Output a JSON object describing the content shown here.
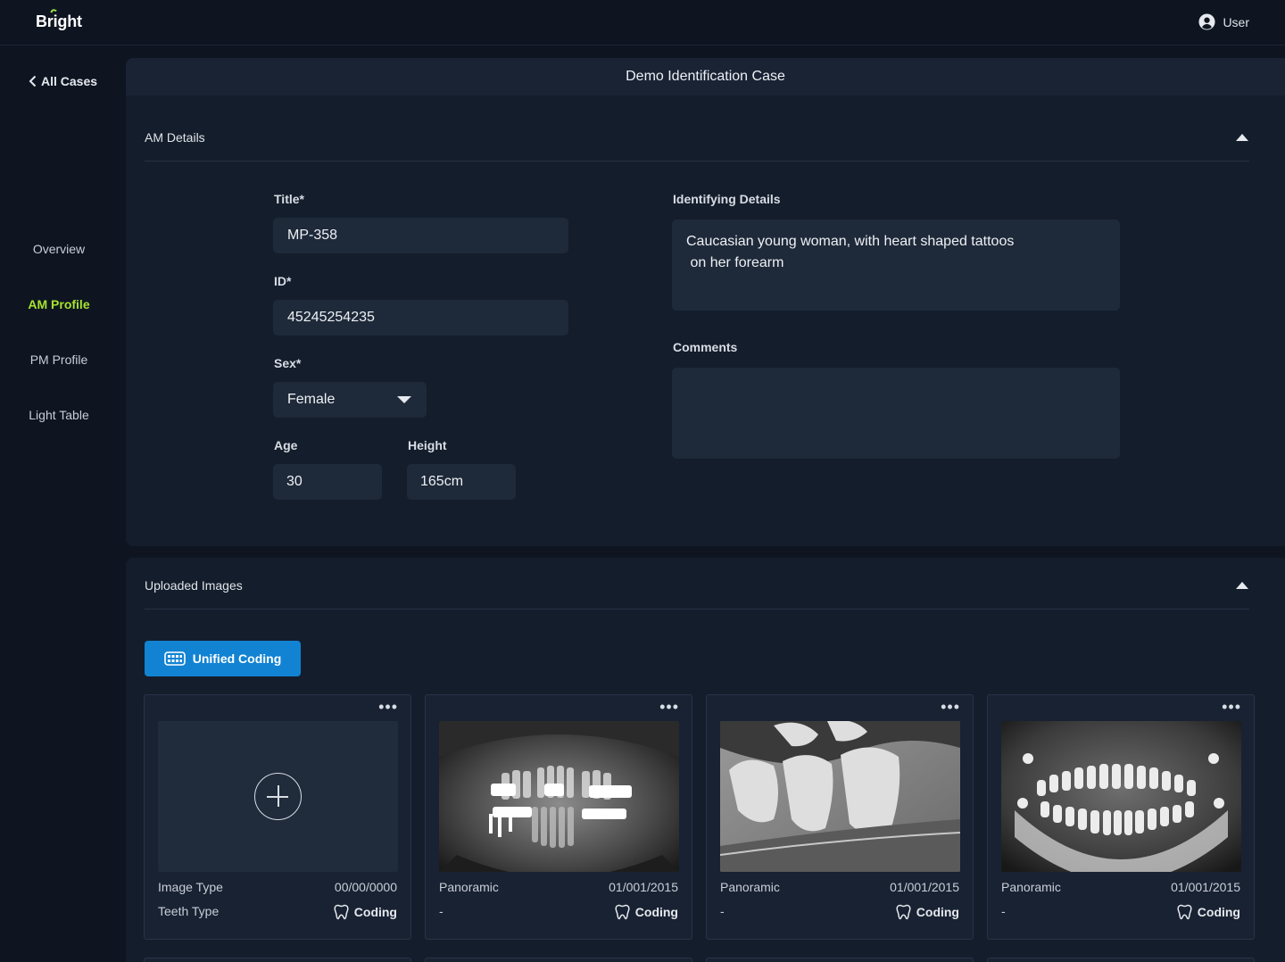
{
  "app": {
    "logo": "Bright",
    "user_label": "User"
  },
  "sidebar": {
    "back_label": "All Cases",
    "items": [
      {
        "label": "Overview",
        "active": false
      },
      {
        "label": "AM Profile",
        "active": true
      },
      {
        "label": "PM Profile",
        "active": false
      },
      {
        "label": "Light Table",
        "active": false
      }
    ]
  },
  "case": {
    "title": "Demo Identification Case"
  },
  "am_details": {
    "section_title": "AM Details",
    "title_label": "Title*",
    "title_value": "MP-358",
    "id_label": "ID*",
    "id_value": "45245254235",
    "sex_label": "Sex*",
    "sex_value": "Female",
    "age_label": "Age",
    "age_value": "30",
    "height_label": "Height",
    "height_value": "165cm",
    "identifying_label": "Identifying Details",
    "identifying_value": "Caucasian young woman, with heart shaped tattoos\n on her forearm",
    "comments_label": "Comments",
    "comments_value": ""
  },
  "uploaded_images": {
    "section_title": "Uploaded Images",
    "unified_button": "Unified Coding",
    "more_glyph": "•••",
    "cards": [
      {
        "type": "Image Type",
        "date": "00/00/0000",
        "teeth": "Teeth Type",
        "coding": "Coding"
      },
      {
        "type": "Panoramic",
        "date": "01/001/2015",
        "teeth": "-",
        "coding": "Coding"
      },
      {
        "type": "Panoramic",
        "date": "01/001/2015",
        "teeth": "-",
        "coding": "Coding"
      },
      {
        "type": "Panoramic",
        "date": "01/001/2015",
        "teeth": "-",
        "coding": "Coding"
      }
    ]
  },
  "colors": {
    "accent_active": "#a6e22e",
    "primary_button": "#1283d3",
    "background": "#0e1521",
    "panel": "#141d2b",
    "field": "#1e2939"
  }
}
